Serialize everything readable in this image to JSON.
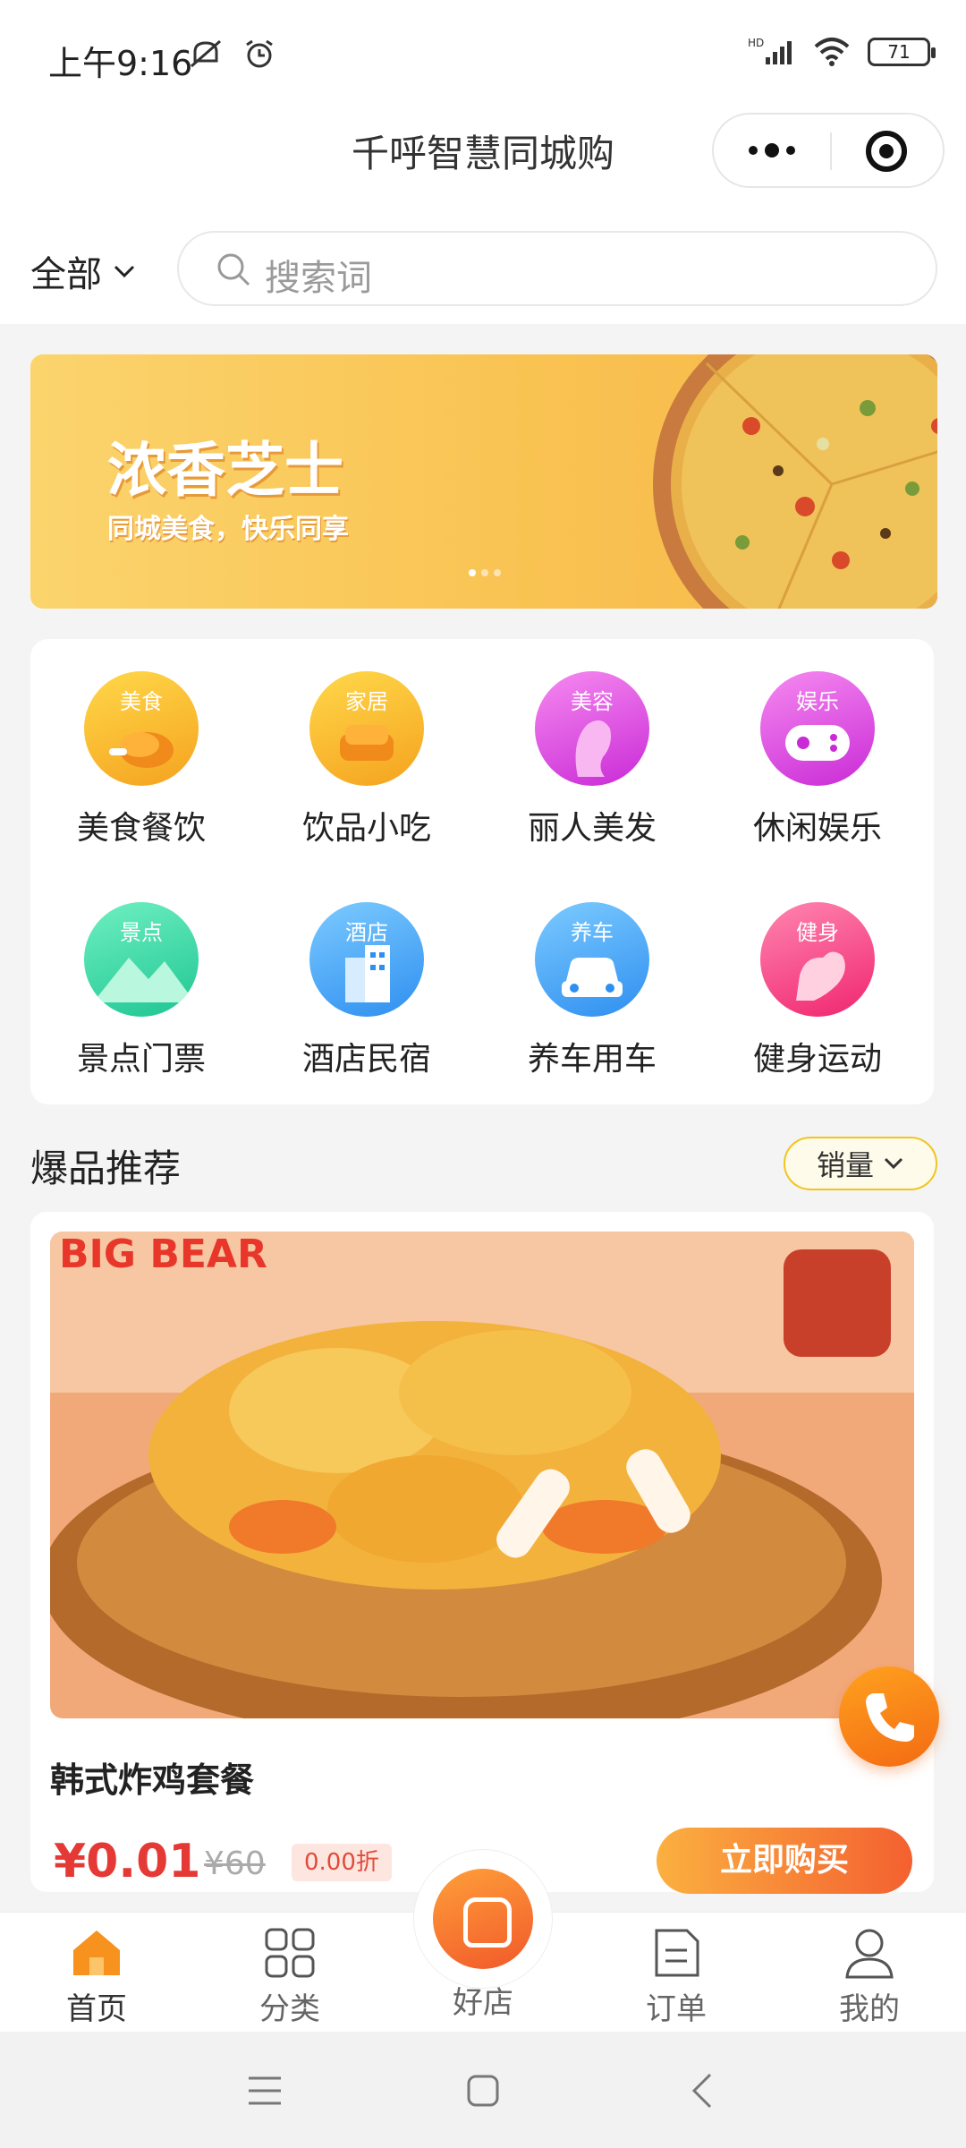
{
  "status_bar": {
    "time": "上午9:16",
    "battery": "71",
    "network": "HD"
  },
  "header": {
    "title": "千呼智慧同城购"
  },
  "filter": {
    "all_label": "全部",
    "search_placeholder": "搜索词"
  },
  "banner": {
    "title": "浓香芝士",
    "subtitle": "同城美食，快乐同享"
  },
  "categories": [
    {
      "tag": "美食",
      "label": "美食餐饮",
      "icon": "roast-chicken-icon",
      "color_from": "#ffd84a",
      "color_to": "#f5a21e"
    },
    {
      "tag": "家居",
      "label": "饮品小吃",
      "icon": "sofa-icon",
      "color_from": "#ffd84a",
      "color_to": "#f5a21e"
    },
    {
      "tag": "美容",
      "label": "丽人美发",
      "icon": "woman-profile-icon",
      "color_from": "#f68af0",
      "color_to": "#c92ad6"
    },
    {
      "tag": "娱乐",
      "label": "休闲娱乐",
      "icon": "gamepad-icon",
      "color_from": "#f68af0",
      "color_to": "#c92ad6"
    },
    {
      "tag": "景点",
      "label": "景点门票",
      "icon": "mountain-icon",
      "color_from": "#6ff0c2",
      "color_to": "#1fc592"
    },
    {
      "tag": "酒店",
      "label": "酒店民宿",
      "icon": "building-icon",
      "color_from": "#7ccbff",
      "color_to": "#2f8ff0"
    },
    {
      "tag": "养车",
      "label": "养车用车",
      "icon": "car-icon",
      "color_from": "#7ccbff",
      "color_to": "#2f8ff0"
    },
    {
      "tag": "健身",
      "label": "健身运动",
      "icon": "muscle-arm-icon",
      "color_from": "#ff86b0",
      "color_to": "#f0256f"
    }
  ],
  "section": {
    "title": "爆品推荐",
    "sort_label": "销量"
  },
  "product": {
    "name": "韩式炸鸡套餐",
    "price": "¥0.01",
    "original_price": "¥60",
    "discount": "0.00折",
    "buy_label": "立即购买",
    "photo_text": "BIG BEAR"
  },
  "tabbar": {
    "items": [
      {
        "label": "首页",
        "icon": "home-icon"
      },
      {
        "label": "分类",
        "icon": "grid-icon"
      },
      {
        "label": "好店",
        "icon": "shop-bag-icon"
      },
      {
        "label": "订单",
        "icon": "order-doc-icon"
      },
      {
        "label": "我的",
        "icon": "user-icon"
      }
    ]
  },
  "colors": {
    "accent": "#f46030",
    "price": "#e53935",
    "brand_yellow": "#f9c352"
  }
}
